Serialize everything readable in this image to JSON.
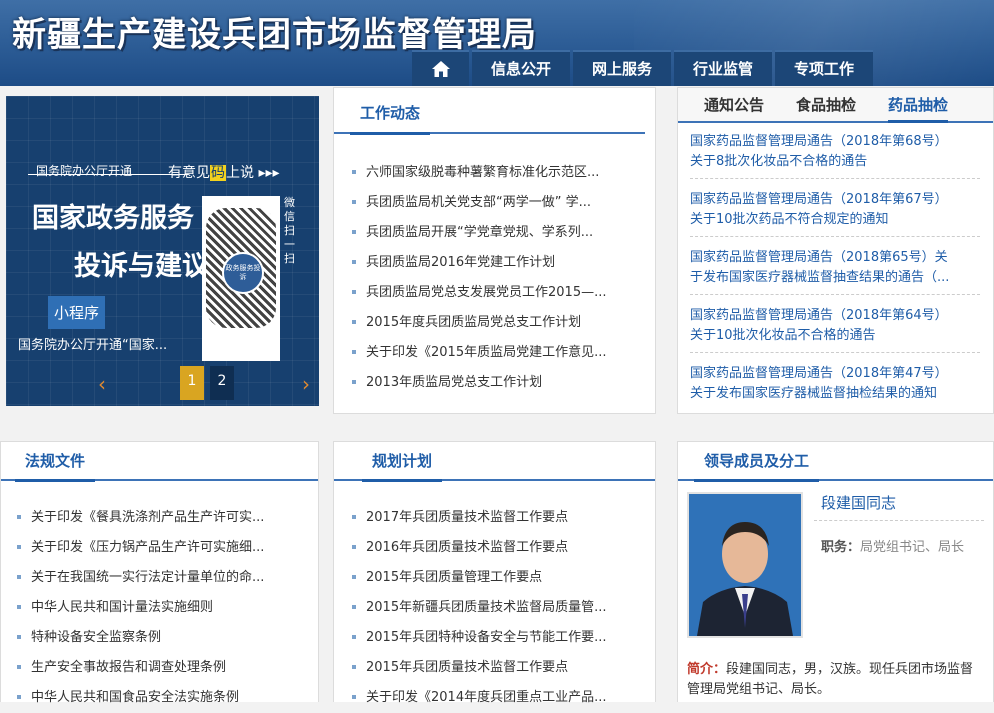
{
  "header": {
    "site_title": "新疆生产建设兵团市场监督管理局",
    "nav": [
      "信息公开",
      "网上服务",
      "行业监管",
      "专项工作"
    ]
  },
  "banner": {
    "top_text": "国务院办公厅开通",
    "headline_1": "国家政务服务",
    "headline_2": "投诉与建议",
    "tag": "小程序",
    "qr_prompt": "有意见",
    "qr_prompt_mark": "码",
    "qr_prompt_after": "上说",
    "qr_side": "微信扫一扫",
    "qr_center": "政务服务投诉",
    "caption": "国务院办公厅开通“国家...",
    "pages": [
      "1",
      "2"
    ],
    "active_page": "1"
  },
  "work_news": {
    "title": "工作动态",
    "items": [
      "六师国家级脱毒种薯繁育标准化示范区...",
      "兵团质监局机关党支部“两学一做” 学...",
      "兵团质监局开展“学党章党规、学系列...",
      "兵团质监局2016年党建工作计划",
      "兵团质监局党总支发展党员工作2015—...",
      "2015年度兵团质监局党总支工作计划",
      "关于印发《2015年质监局党建工作意见...",
      "2013年质监局党总支工作计划"
    ]
  },
  "tabs": {
    "labels": [
      "通知公告",
      "食品抽检",
      "药品抽检"
    ],
    "active": "药品抽检",
    "notices": [
      {
        "line1": "国家药品监督管理局通告（2018年第68号）",
        "line2": "关于8批次化妆品不合格的通告"
      },
      {
        "line1": "国家药品监督管理局通告（2018年第67号）",
        "line2": "关于10批次药品不符合规定的通知"
      },
      {
        "line1": "国家药品监督管理局通告（2018第65号）关",
        "line2": "于发布国家医疗器械监督抽查结果的通告（..."
      },
      {
        "line1": "国家药品监督管理局通告（2018年第64号）",
        "line2": "关于10批次化妆品不合格的通告"
      },
      {
        "line1": "国家药品监督管理局通告（2018年第47号）",
        "line2": "关于发布国家医疗器械监督抽检结果的通知"
      }
    ]
  },
  "regulations": {
    "title": "法规文件",
    "items": [
      "关于印发《餐具洗涤剂产品生产许可实...",
      "关于印发《压力锅产品生产许可实施细...",
      "关于在我国统一实行法定计量单位的命...",
      "中华人民共和国计量法实施细则",
      "特种设备安全监察条例",
      "生产安全事故报告和调查处理条例",
      "中华人民共和国食品安全法实施条例"
    ]
  },
  "plans": {
    "title": "规划计划",
    "items": [
      "2017年兵团质量技术监督工作要点",
      "2016年兵团质量技术监督工作要点",
      "2015年兵团质量管理工作要点",
      "2015年新疆兵团质量技术监督局质量管...",
      "2015年兵团特种设备安全与节能工作要...",
      "2015年兵团质量技术监督工作要点",
      "关于印发《2014年度兵团重点工业产品..."
    ]
  },
  "leaders": {
    "title": "领导成员及分工",
    "name": "段建国同志",
    "duty_label": "职务：",
    "duty_value": "局党组书记、局长",
    "intro_label": "简介：",
    "intro_text": "段建国同志，男，汉族。现任兵团市场监督管理局党组书记、局长。"
  },
  "colors": {
    "accent": "#1f5da8",
    "header": "#2f5f98",
    "nav": "#1c4677",
    "banner": "#17406f",
    "pager_active": "#d9a521"
  }
}
